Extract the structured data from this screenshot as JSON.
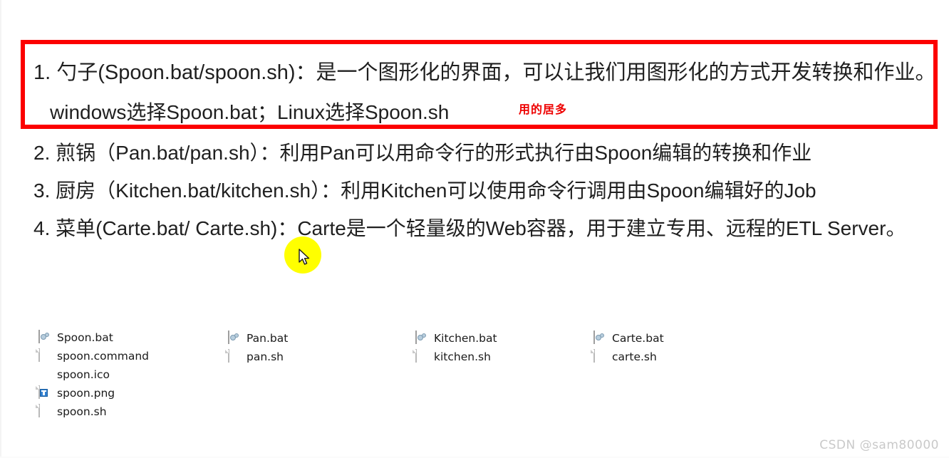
{
  "page": {
    "background_color": "#ffffff",
    "text_color": "#1f1f1f",
    "highlight_box_color": "#fc0000",
    "annotation_color": "#ee0000",
    "cursor_highlight_color": "#ffff00"
  },
  "list": {
    "item1": {
      "number": "1.",
      "line1": "勺子(Spoon.bat/spoon.sh)：是一个图形化的界面，可以让我们用图形化的方式开发转换和作业。",
      "line2": "windows选择Spoon.bat；Linux选择Spoon.sh"
    },
    "item2": {
      "number": "2.",
      "text": "煎锅（Pan.bat/pan.sh）：利用Pan可以用命令行的形式执行由Spoon编辑的转换和作业"
    },
    "item3": {
      "number": "3.",
      "text": "厨房（Kitchen.bat/kitchen.sh）：利用Kitchen可以使用命令行调用由Spoon编辑好的Job"
    },
    "item4": {
      "number": "4.",
      "text": "菜单(Carte.bat/ Carte.sh)：Carte是一个轻量级的Web容器，用于建立专用、远程的ETL Server。"
    }
  },
  "annotation": {
    "text": "用的居多"
  },
  "files": {
    "columns": [
      {
        "name": "spoon-files",
        "rows": [
          {
            "icon": "bat-script-icon",
            "label": "Spoon.bat"
          },
          {
            "icon": "blank-document-icon",
            "label": "spoon.command"
          },
          {
            "icon": "ico-image-icon",
            "label": "spoon.ico"
          },
          {
            "icon": "png-image-icon",
            "label": "spoon.png"
          },
          {
            "icon": "blank-document-icon",
            "label": "spoon.sh"
          }
        ]
      },
      {
        "name": "pan-files",
        "rows": [
          {
            "icon": "bat-script-icon",
            "label": "Pan.bat"
          },
          {
            "icon": "blank-document-icon",
            "label": "pan.sh"
          }
        ]
      },
      {
        "name": "kitchen-files",
        "rows": [
          {
            "icon": "bat-script-icon",
            "label": "Kitchen.bat"
          },
          {
            "icon": "blank-document-icon",
            "label": "kitchen.sh"
          }
        ]
      },
      {
        "name": "carte-files",
        "rows": [
          {
            "icon": "bat-script-icon",
            "label": "Carte.bat"
          },
          {
            "icon": "blank-document-icon",
            "label": "carte.sh"
          }
        ]
      }
    ]
  },
  "watermark": {
    "text": "CSDN @sam80000"
  }
}
